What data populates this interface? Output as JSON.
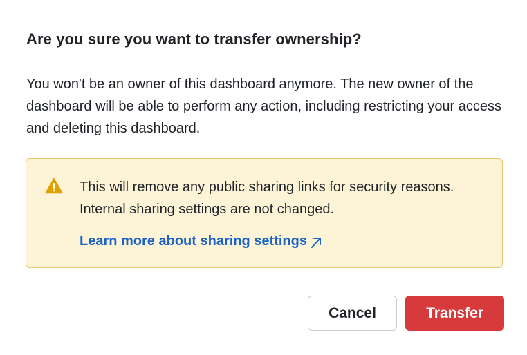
{
  "dialog": {
    "title": "Are you sure you want to transfer ownership?",
    "body": "You won't be an owner of this dashboard anymore. The new owner of the dashboard will be able to perform any action, including restricting your access and deleting this dashboard.",
    "warning": {
      "icon": "warning-triangle-icon",
      "text": "This will remove any public sharing links for security reasons. Internal sharing settings are not changed.",
      "link_label": "Learn more about sharing settings",
      "link_icon": "external-link-arrow-icon"
    },
    "buttons": {
      "cancel_label": "Cancel",
      "transfer_label": "Transfer"
    }
  },
  "colors": {
    "warning_background": "#fdf4d7",
    "warning_border": "#e9c46a",
    "warning_icon": "#e0a100",
    "link": "#1a62c7",
    "danger_button": "#d73a3a"
  }
}
